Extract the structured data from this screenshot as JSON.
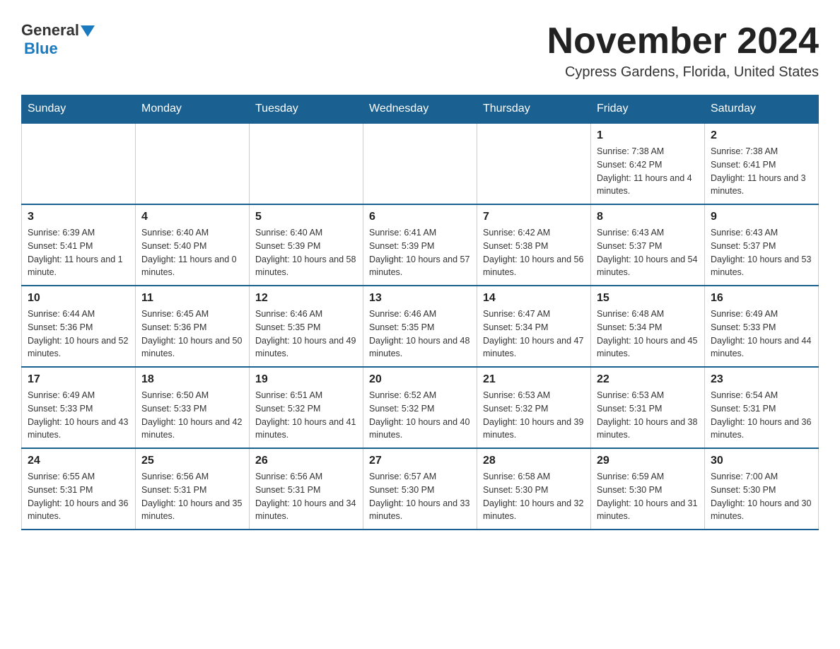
{
  "header": {
    "logo_general": "General",
    "logo_blue": "Blue",
    "month_title": "November 2024",
    "location": "Cypress Gardens, Florida, United States"
  },
  "days_of_week": [
    "Sunday",
    "Monday",
    "Tuesday",
    "Wednesday",
    "Thursday",
    "Friday",
    "Saturday"
  ],
  "weeks": [
    [
      {
        "day": "",
        "info": ""
      },
      {
        "day": "",
        "info": ""
      },
      {
        "day": "",
        "info": ""
      },
      {
        "day": "",
        "info": ""
      },
      {
        "day": "",
        "info": ""
      },
      {
        "day": "1",
        "info": "Sunrise: 7:38 AM\nSunset: 6:42 PM\nDaylight: 11 hours and 4 minutes."
      },
      {
        "day": "2",
        "info": "Sunrise: 7:38 AM\nSunset: 6:41 PM\nDaylight: 11 hours and 3 minutes."
      }
    ],
    [
      {
        "day": "3",
        "info": "Sunrise: 6:39 AM\nSunset: 5:41 PM\nDaylight: 11 hours and 1 minute."
      },
      {
        "day": "4",
        "info": "Sunrise: 6:40 AM\nSunset: 5:40 PM\nDaylight: 11 hours and 0 minutes."
      },
      {
        "day": "5",
        "info": "Sunrise: 6:40 AM\nSunset: 5:39 PM\nDaylight: 10 hours and 58 minutes."
      },
      {
        "day": "6",
        "info": "Sunrise: 6:41 AM\nSunset: 5:39 PM\nDaylight: 10 hours and 57 minutes."
      },
      {
        "day": "7",
        "info": "Sunrise: 6:42 AM\nSunset: 5:38 PM\nDaylight: 10 hours and 56 minutes."
      },
      {
        "day": "8",
        "info": "Sunrise: 6:43 AM\nSunset: 5:37 PM\nDaylight: 10 hours and 54 minutes."
      },
      {
        "day": "9",
        "info": "Sunrise: 6:43 AM\nSunset: 5:37 PM\nDaylight: 10 hours and 53 minutes."
      }
    ],
    [
      {
        "day": "10",
        "info": "Sunrise: 6:44 AM\nSunset: 5:36 PM\nDaylight: 10 hours and 52 minutes."
      },
      {
        "day": "11",
        "info": "Sunrise: 6:45 AM\nSunset: 5:36 PM\nDaylight: 10 hours and 50 minutes."
      },
      {
        "day": "12",
        "info": "Sunrise: 6:46 AM\nSunset: 5:35 PM\nDaylight: 10 hours and 49 minutes."
      },
      {
        "day": "13",
        "info": "Sunrise: 6:46 AM\nSunset: 5:35 PM\nDaylight: 10 hours and 48 minutes."
      },
      {
        "day": "14",
        "info": "Sunrise: 6:47 AM\nSunset: 5:34 PM\nDaylight: 10 hours and 47 minutes."
      },
      {
        "day": "15",
        "info": "Sunrise: 6:48 AM\nSunset: 5:34 PM\nDaylight: 10 hours and 45 minutes."
      },
      {
        "day": "16",
        "info": "Sunrise: 6:49 AM\nSunset: 5:33 PM\nDaylight: 10 hours and 44 minutes."
      }
    ],
    [
      {
        "day": "17",
        "info": "Sunrise: 6:49 AM\nSunset: 5:33 PM\nDaylight: 10 hours and 43 minutes."
      },
      {
        "day": "18",
        "info": "Sunrise: 6:50 AM\nSunset: 5:33 PM\nDaylight: 10 hours and 42 minutes."
      },
      {
        "day": "19",
        "info": "Sunrise: 6:51 AM\nSunset: 5:32 PM\nDaylight: 10 hours and 41 minutes."
      },
      {
        "day": "20",
        "info": "Sunrise: 6:52 AM\nSunset: 5:32 PM\nDaylight: 10 hours and 40 minutes."
      },
      {
        "day": "21",
        "info": "Sunrise: 6:53 AM\nSunset: 5:32 PM\nDaylight: 10 hours and 39 minutes."
      },
      {
        "day": "22",
        "info": "Sunrise: 6:53 AM\nSunset: 5:31 PM\nDaylight: 10 hours and 38 minutes."
      },
      {
        "day": "23",
        "info": "Sunrise: 6:54 AM\nSunset: 5:31 PM\nDaylight: 10 hours and 36 minutes."
      }
    ],
    [
      {
        "day": "24",
        "info": "Sunrise: 6:55 AM\nSunset: 5:31 PM\nDaylight: 10 hours and 36 minutes."
      },
      {
        "day": "25",
        "info": "Sunrise: 6:56 AM\nSunset: 5:31 PM\nDaylight: 10 hours and 35 minutes."
      },
      {
        "day": "26",
        "info": "Sunrise: 6:56 AM\nSunset: 5:31 PM\nDaylight: 10 hours and 34 minutes."
      },
      {
        "day": "27",
        "info": "Sunrise: 6:57 AM\nSunset: 5:30 PM\nDaylight: 10 hours and 33 minutes."
      },
      {
        "day": "28",
        "info": "Sunrise: 6:58 AM\nSunset: 5:30 PM\nDaylight: 10 hours and 32 minutes."
      },
      {
        "day": "29",
        "info": "Sunrise: 6:59 AM\nSunset: 5:30 PM\nDaylight: 10 hours and 31 minutes."
      },
      {
        "day": "30",
        "info": "Sunrise: 7:00 AM\nSunset: 5:30 PM\nDaylight: 10 hours and 30 minutes."
      }
    ]
  ]
}
